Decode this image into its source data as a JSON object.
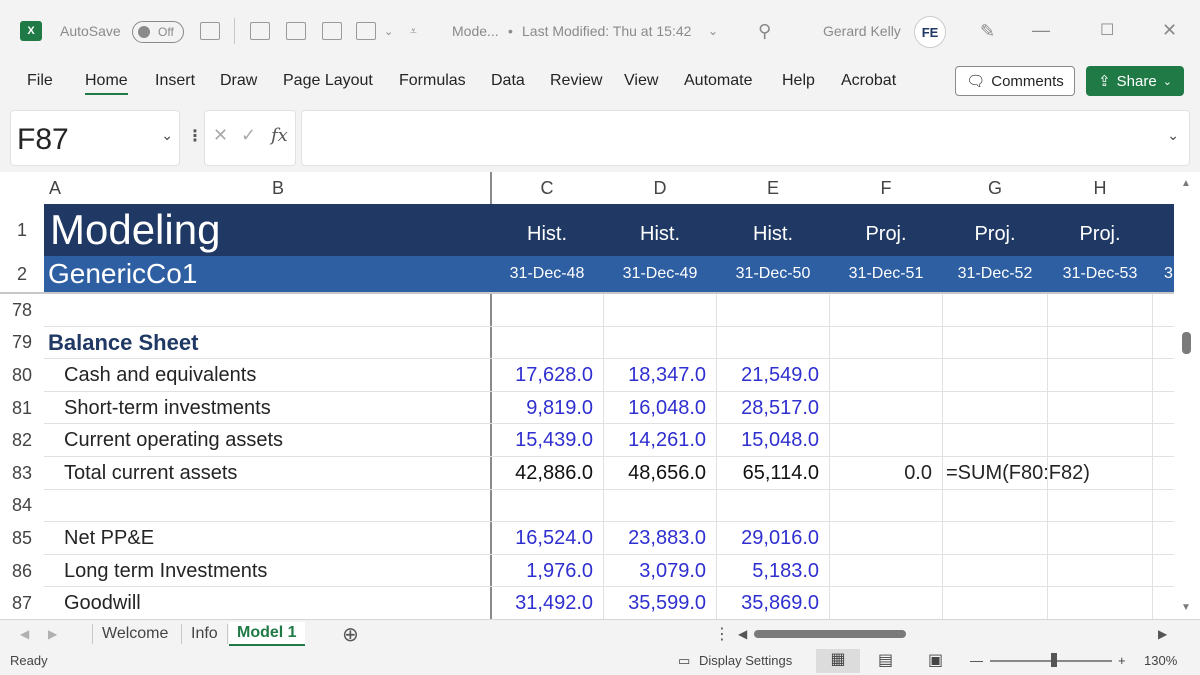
{
  "titlebar": {
    "app_icon": "X",
    "autosave_label": "AutoSave",
    "autosave_state": "Off",
    "doc_title": "Mode...",
    "modified": "Last Modified: Thu at 15:42",
    "user_name": "Gerard Kelly",
    "user_initials": "FE",
    "icons": [
      "save-icon",
      "undo-icon",
      "camera-icon",
      "form-icon",
      "align-icon",
      "customize-icon",
      "search-icon",
      "designer-icon",
      "minimize-icon",
      "maximize-icon",
      "close-icon"
    ]
  },
  "menu": {
    "items": [
      "File",
      "Home",
      "Insert",
      "Draw",
      "Page Layout",
      "Formulas",
      "Data",
      "Review",
      "View",
      "Automate",
      "Help",
      "Acrobat"
    ],
    "active": "Home",
    "comments_label": "Comments",
    "share_label": "Share"
  },
  "formula_bar": {
    "name_box": "F87",
    "fx": "fx",
    "formula": ""
  },
  "columns": [
    "A",
    "B",
    "C",
    "D",
    "E",
    "F",
    "G",
    "H"
  ],
  "header_rows": {
    "row1": {
      "num": "1",
      "title": "Modeling",
      "labels": [
        "Hist.",
        "Hist.",
        "Hist.",
        "Proj.",
        "Proj.",
        "Proj."
      ]
    },
    "row2": {
      "num": "2",
      "subtitle": "GenericCo1",
      "dates": [
        "31-Dec-48",
        "31-Dec-49",
        "31-Dec-50",
        "31-Dec-51",
        "31-Dec-52",
        "31-Dec-53",
        "3"
      ]
    }
  },
  "rows": [
    {
      "num": "78",
      "label": "",
      "indent": false,
      "bold": false,
      "values": [
        "",
        "",
        ""
      ],
      "f": "",
      "g": ""
    },
    {
      "num": "79",
      "label": "Balance Sheet",
      "indent": false,
      "bold": true,
      "values": [
        "",
        "",
        ""
      ],
      "f": "",
      "g": ""
    },
    {
      "num": "80",
      "label": "Cash and equivalents",
      "indent": true,
      "bold": false,
      "values": [
        "17,628.0",
        "18,347.0",
        "21,549.0"
      ],
      "f": "",
      "g": "",
      "input": true
    },
    {
      "num": "81",
      "label": "Short-term investments",
      "indent": true,
      "bold": false,
      "values": [
        "9,819.0",
        "16,048.0",
        "28,517.0"
      ],
      "f": "",
      "g": "",
      "input": true
    },
    {
      "num": "82",
      "label": "Current operating assets",
      "indent": true,
      "bold": false,
      "values": [
        "15,439.0",
        "14,261.0",
        "15,048.0"
      ],
      "f": "",
      "g": "",
      "input": true
    },
    {
      "num": "83",
      "label": "Total current assets",
      "indent": true,
      "bold": false,
      "values": [
        "42,886.0",
        "48,656.0",
        "65,114.0"
      ],
      "f": "0.0",
      "g": "=SUM(F80:F82)",
      "input": false
    },
    {
      "num": "84",
      "label": "",
      "indent": false,
      "bold": false,
      "values": [
        "",
        "",
        ""
      ],
      "f": "",
      "g": ""
    },
    {
      "num": "85",
      "label": "Net PP&E",
      "indent": true,
      "bold": false,
      "values": [
        "16,524.0",
        "23,883.0",
        "29,016.0"
      ],
      "f": "",
      "g": "",
      "input": true
    },
    {
      "num": "86",
      "label": "Long term Investments",
      "indent": true,
      "bold": false,
      "values": [
        "1,976.0",
        "3,079.0",
        "5,183.0"
      ],
      "f": "",
      "g": "",
      "input": true
    },
    {
      "num": "87",
      "label": "Goodwill",
      "indent": true,
      "bold": false,
      "values": [
        "31,492.0",
        "35,599.0",
        "35,869.0"
      ],
      "f": "",
      "g": "",
      "input": true
    }
  ],
  "colors": {
    "header_dark": "#1f3864",
    "header_mid": "#2e5fa3",
    "input_blue": "#2f2fd0",
    "section_title": "#1f3864",
    "excel_green": "#1f7a45"
  },
  "tabs": {
    "items": [
      "Welcome",
      "Info",
      "Model 1"
    ],
    "active": "Model 1",
    "add_icon": "add-sheet-icon"
  },
  "status": {
    "ready": "Ready",
    "display_settings": "Display Settings",
    "zoom": "130%",
    "views": [
      "normal-view-icon",
      "page-layout-view-icon",
      "page-break-view-icon"
    ]
  }
}
